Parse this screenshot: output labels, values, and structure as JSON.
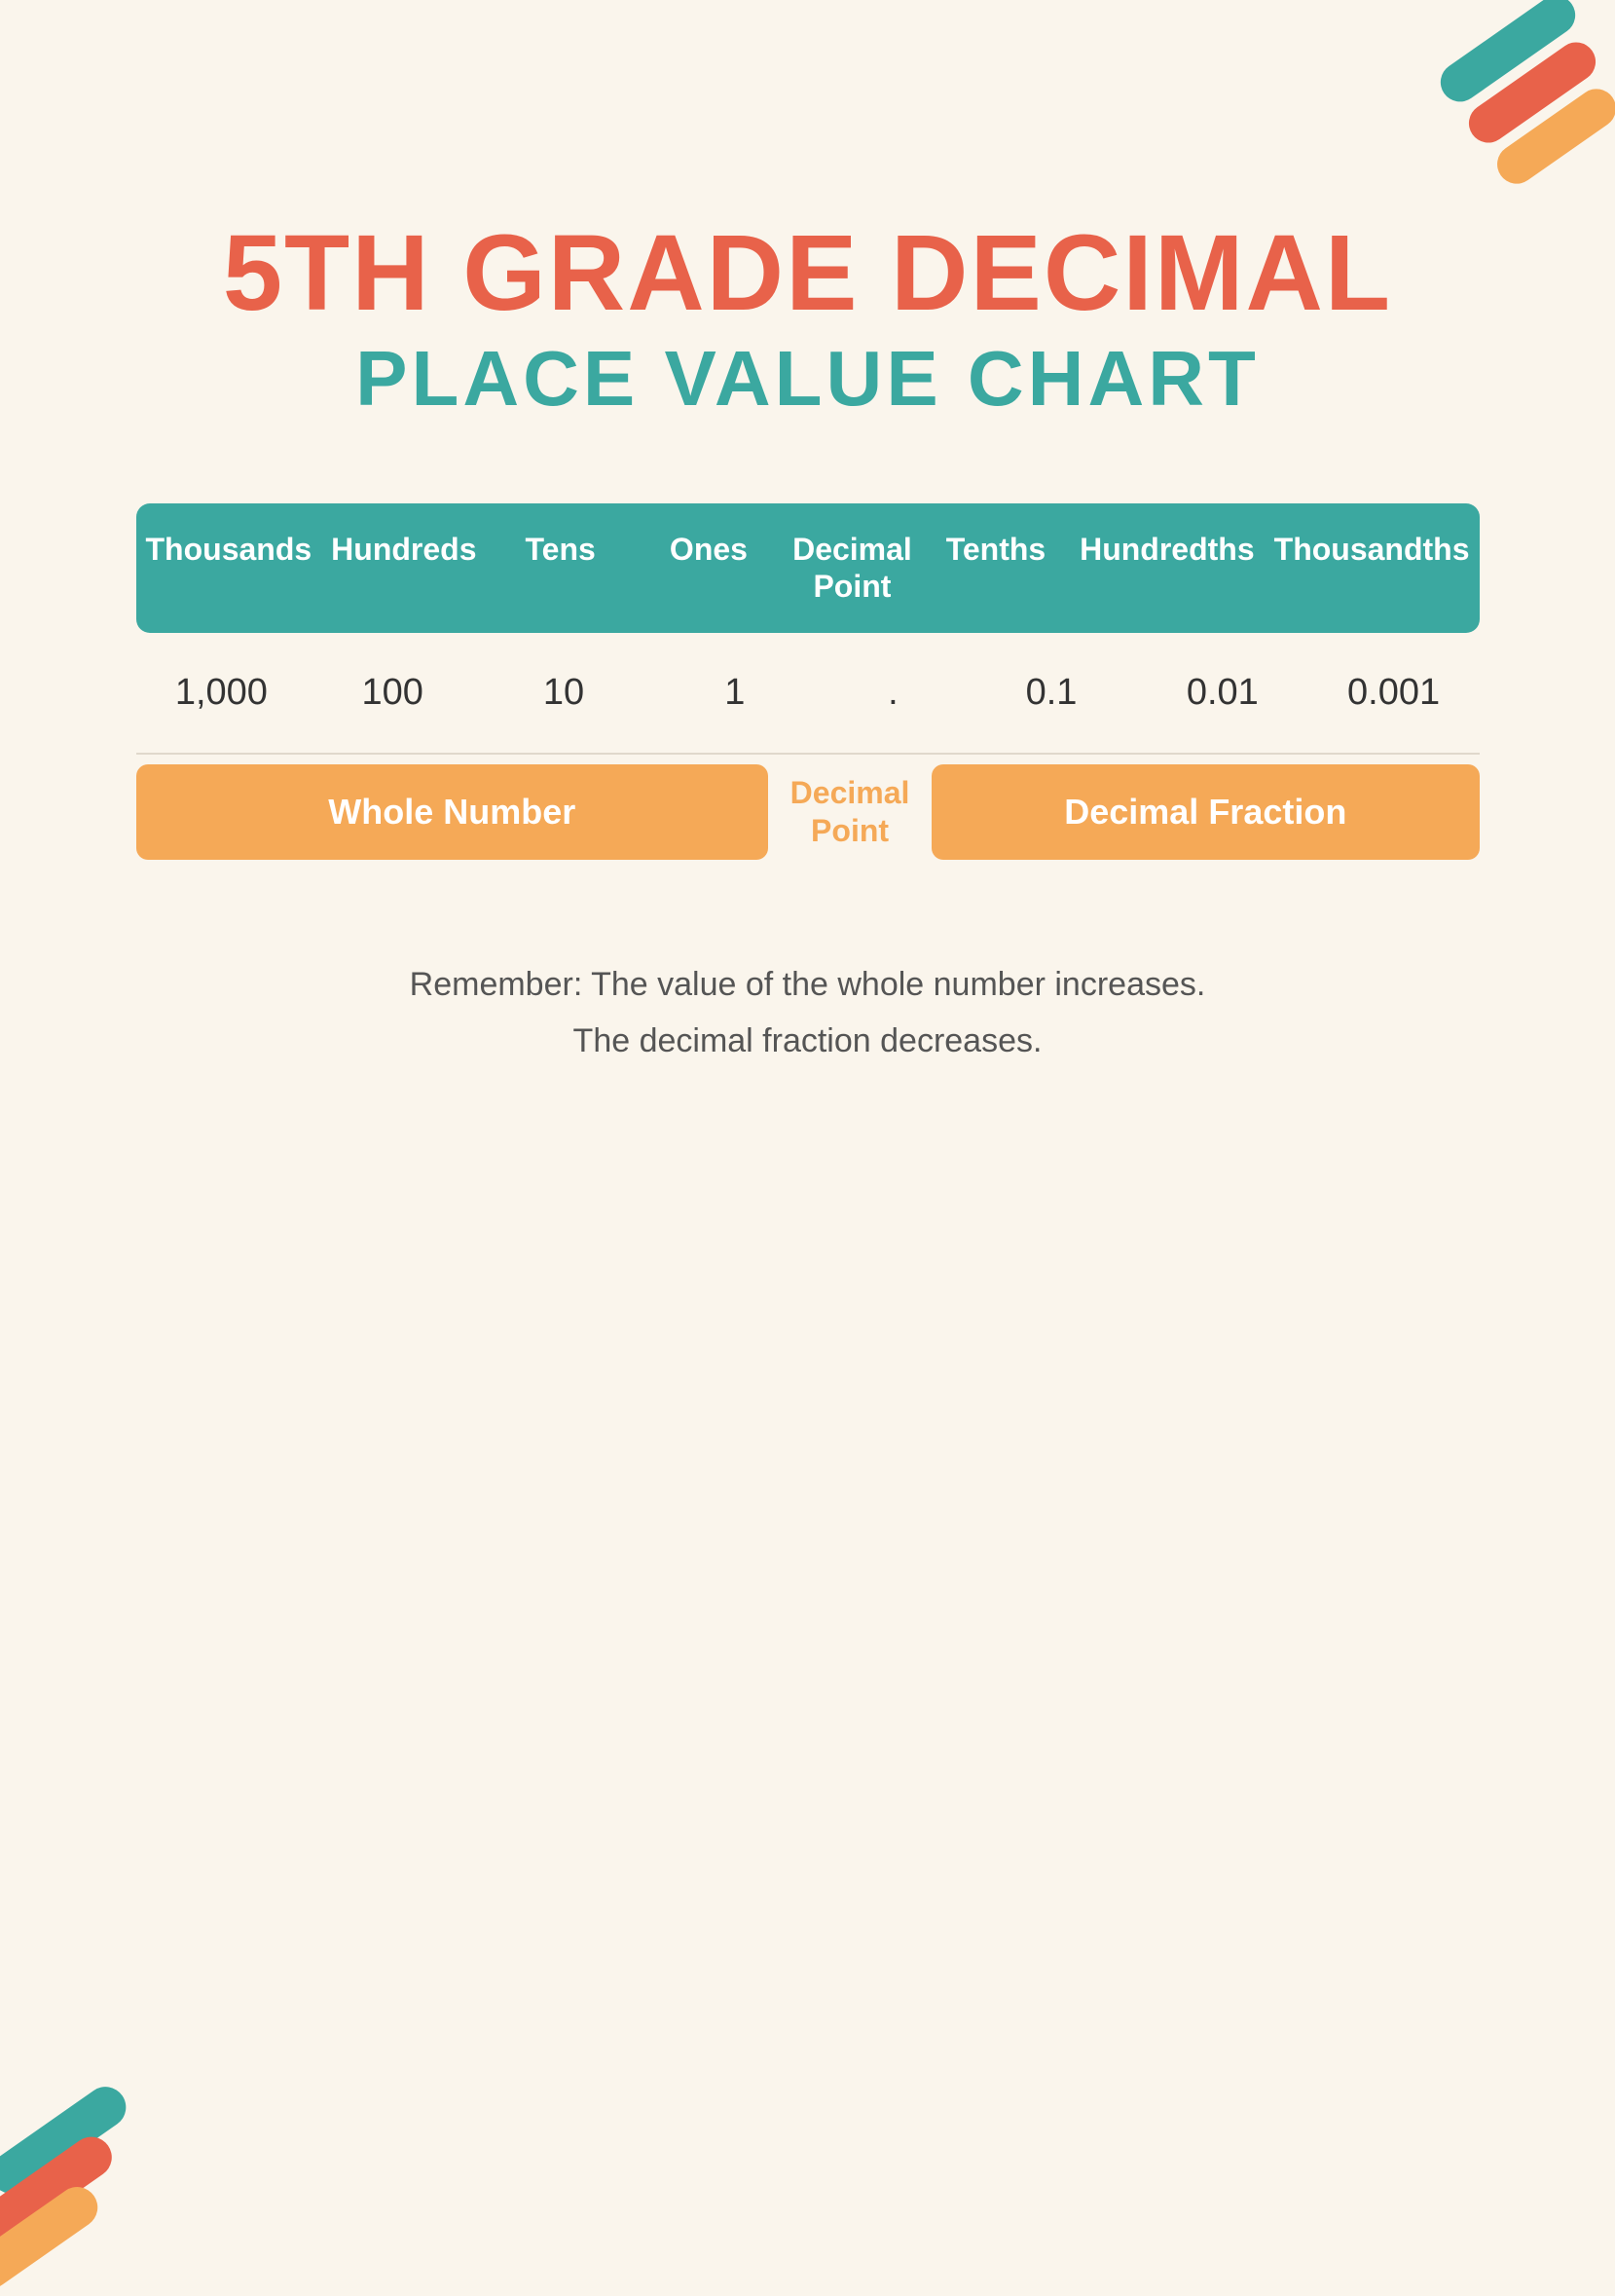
{
  "page": {
    "background_color": "#FAF5EC",
    "title_line1": "5TH GRADE DECIMAL",
    "title_line2": "PLACE VALUE CHART"
  },
  "colors": {
    "teal": "#3BA8A0",
    "orange_red": "#E8624A",
    "orange": "#F5A957",
    "white": "#FFFFFF"
  },
  "table": {
    "headers": [
      {
        "id": "thousands",
        "label": "Thousands"
      },
      {
        "id": "hundreds",
        "label": "Hundreds"
      },
      {
        "id": "tens",
        "label": "Tens"
      },
      {
        "id": "ones",
        "label": "Ones"
      },
      {
        "id": "decimal_point",
        "label": "Decimal Point"
      },
      {
        "id": "tenths",
        "label": "Tenths"
      },
      {
        "id": "hundredths",
        "label": "Hundredths"
      },
      {
        "id": "thousandths",
        "label": "Thousandths"
      }
    ],
    "values": [
      {
        "id": "thousands_val",
        "value": "1,000"
      },
      {
        "id": "hundreds_val",
        "value": "100"
      },
      {
        "id": "tens_val",
        "value": "10"
      },
      {
        "id": "ones_val",
        "value": "1"
      },
      {
        "id": "decimal_point_val",
        "value": "."
      },
      {
        "id": "tenths_val",
        "value": "0.1"
      },
      {
        "id": "hundredths_val",
        "value": "0.01"
      },
      {
        "id": "thousandths_val",
        "value": "0.001"
      }
    ],
    "labels": {
      "whole_number": "Whole Number",
      "decimal_point": "Decimal Point",
      "decimal_fraction": "Decimal Fraction"
    }
  },
  "remember": {
    "line1": "Remember: The value of the whole number increases.",
    "line2": "The decimal fraction decreases."
  }
}
